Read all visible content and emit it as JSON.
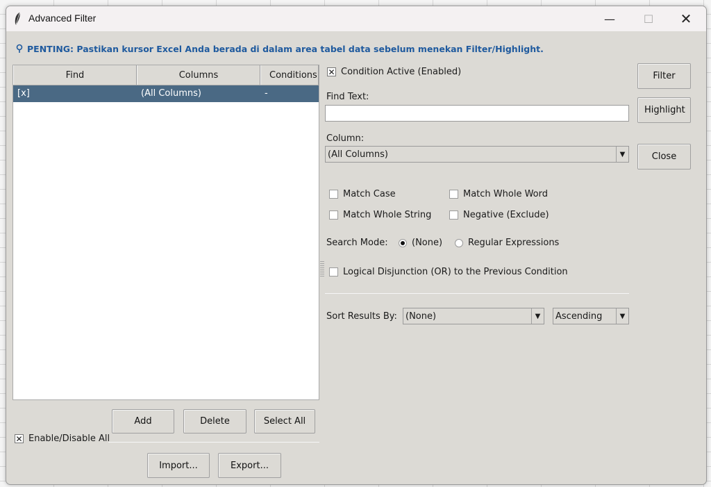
{
  "window": {
    "title": "Advanced Filter",
    "controls": {
      "minimize": "—",
      "maximize": "☐",
      "close": "✕"
    }
  },
  "notice": "PENTING: Pastikan kursor Excel Anda berada di dalam area tabel data sebelum menekan Filter/Highlight.",
  "table": {
    "headers": [
      "Find",
      "Columns",
      "Conditions"
    ],
    "rows": [
      {
        "find": "[x]",
        "columns": "(All Columns)",
        "conditions": "-"
      }
    ]
  },
  "list_buttons": {
    "add": "Add",
    "delete": "Delete",
    "select_all": "Select All"
  },
  "enable_all": {
    "label": "Enable/Disable All",
    "checked": true
  },
  "io_buttons": {
    "import": "Import...",
    "export": "Export..."
  },
  "condition": {
    "active_label": "Condition Active (Enabled)",
    "active_checked": true,
    "find_text_label": "Find Text:",
    "find_text_value": "",
    "column_label": "Column:",
    "column_value": "(All Columns)"
  },
  "options": {
    "match_case": "Match Case",
    "match_whole_word": "Match Whole Word",
    "match_whole_string": "Match Whole String",
    "negative": "Negative (Exclude)"
  },
  "search_mode": {
    "label": "Search Mode:",
    "none": "(None)",
    "regex": "Regular Expressions",
    "selected": "none"
  },
  "disjunction_label": "Logical Disjunction (OR) to the Previous Condition",
  "sort": {
    "label": "Sort Results By:",
    "by_value": "(None)",
    "order_value": "Ascending"
  },
  "side_buttons": {
    "filter": "Filter",
    "highlight": "Highlight",
    "close": "Close"
  },
  "colors": {
    "selection": "#4a6984",
    "notice": "#1f5a9e",
    "dialog_bg": "#dcdad5"
  }
}
